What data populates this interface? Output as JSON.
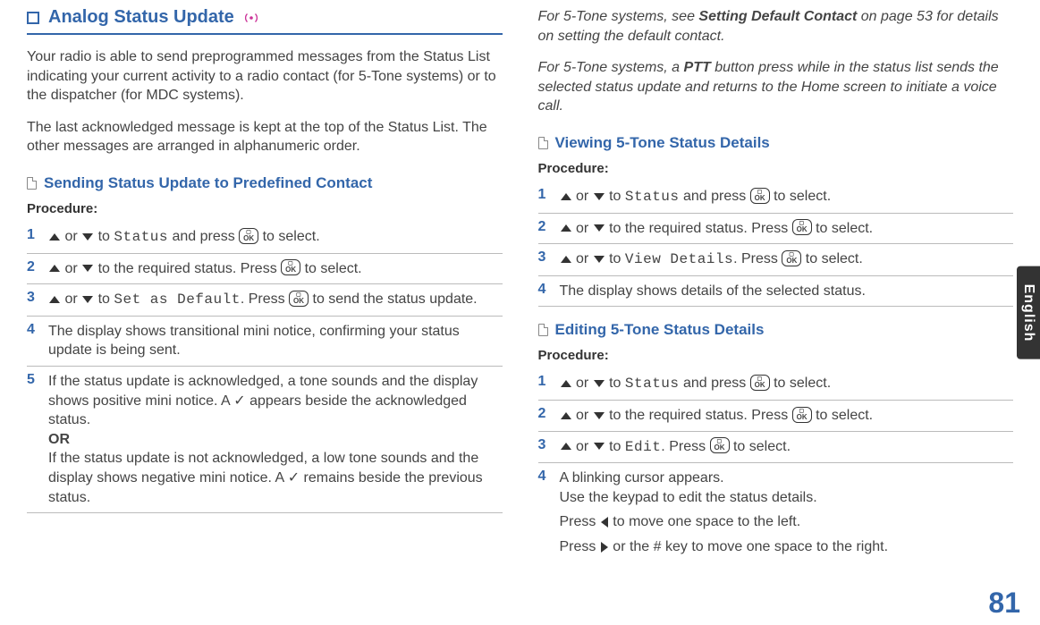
{
  "page_number": "81",
  "side_tab": "English",
  "left": {
    "header": "Analog Status Update",
    "intro1": "Your radio is able to send preprogrammed messages from the Status List indicating your current activity to a radio contact (for 5-Tone systems) or to the dispatcher (for MDC systems).",
    "intro2": "The last acknowledged message is kept at the top of the Status List. The other messages are arranged in alphanumeric order.",
    "sub1_title": "Sending Status Update to Predefined Contact",
    "proc_label": "Procedure:",
    "steps": [
      {
        "n": "1",
        "pre": "or",
        "mid": "to ",
        "mono": "Status",
        "tail": " and press ",
        "post": " to select."
      },
      {
        "n": "2",
        "pre": "or",
        "mid": "to the required status. Press ",
        "post": " to select."
      },
      {
        "n": "3",
        "pre": "or",
        "mid": "to ",
        "mono": "Set as Default",
        "tail": ". Press ",
        "post": " to send the status update."
      },
      {
        "n": "4",
        "text": "The display shows transitional mini notice, confirming your status update is being sent."
      },
      {
        "n": "5",
        "text_a": "If the status update is acknowledged, a tone sounds and the display shows positive mini notice. A ✓ appears beside the acknowledged status.",
        "or": "OR",
        "text_b": "If the status update is not acknowledged, a low tone sounds and the display shows negative mini notice. A ✓ remains beside the previous status."
      }
    ]
  },
  "right": {
    "note1_a": "For 5-Tone systems, see ",
    "note1_b": "Setting Default Contact",
    "note1_c": " on page 53 for details on setting the default contact.",
    "note2_a": "For 5-Tone systems, a ",
    "note2_b": "PTT",
    "note2_c": " button press while in the status list sends the selected status update and returns to the Home screen to initiate a voice call.",
    "sub2_title": "Viewing 5-Tone Status Details",
    "proc_label": "Procedure:",
    "view_steps": [
      {
        "n": "1",
        "pre": "or",
        "mid": "to ",
        "mono": "Status",
        "tail": " and press ",
        "post": " to select."
      },
      {
        "n": "2",
        "pre": "or",
        "mid": "to the required status. Press ",
        "post": " to select."
      },
      {
        "n": "3",
        "pre": "or",
        "mid": "to ",
        "mono": "View Details",
        "tail": ". Press ",
        "post": " to select."
      },
      {
        "n": "4",
        "text": "The display shows details of the selected status."
      }
    ],
    "sub3_title": "Editing 5-Tone Status Details",
    "edit_steps": [
      {
        "n": "1",
        "pre": "or",
        "mid": "to ",
        "mono": "Status",
        "tail": " and press ",
        "post": " to select."
      },
      {
        "n": "2",
        "pre": "or",
        "mid": "to the required status. Press ",
        "post": " to select."
      },
      {
        "n": "3",
        "pre": "or",
        "mid": "to ",
        "mono": "Edit",
        "tail": ". Press ",
        "post": " to select."
      },
      {
        "n": "4",
        "t1": "A blinking cursor appears.",
        "t2": "Use the keypad to edit the status details.",
        "t3": "Press ",
        "t3b": " to move one space to the left.",
        "t4": "Press ",
        "t4b": " or the # key to move one space to the right."
      }
    ]
  }
}
